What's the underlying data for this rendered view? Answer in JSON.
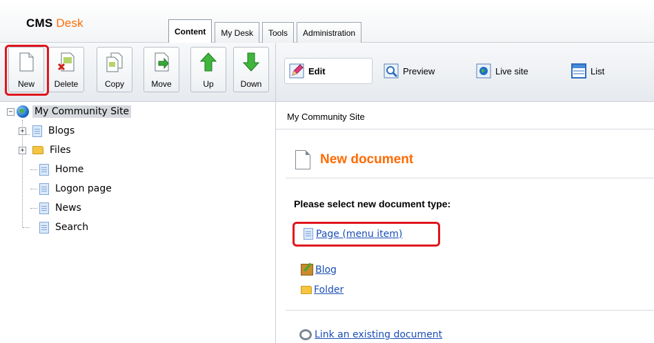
{
  "app": {
    "logo_main": "CMS",
    "logo_accent": "Desk"
  },
  "tabs": [
    {
      "label": "Content",
      "active": true
    },
    {
      "label": "My Desk"
    },
    {
      "label": "Tools"
    },
    {
      "label": "Administration"
    }
  ],
  "toolbar": {
    "new": "New",
    "delete": "Delete",
    "copy": "Copy",
    "move": "Move",
    "up": "Up",
    "down": "Down"
  },
  "view_modes": {
    "edit": "Edit",
    "preview": "Preview",
    "live_site": "Live site",
    "list": "List"
  },
  "tree": {
    "root": "My Community Site",
    "items": [
      "Blogs",
      "Files",
      "Home",
      "Logon page",
      "News",
      "Search"
    ]
  },
  "breadcrumb": "My Community Site",
  "content": {
    "title": "New document",
    "prompt": "Please select new document type:",
    "doc_types": [
      "Page (menu item)",
      "Blog",
      "Folder"
    ],
    "link_existing": "Link an existing document"
  },
  "colors": {
    "accent": "#ff6a00",
    "highlight": "#e0141c",
    "link": "#1a4db5"
  }
}
